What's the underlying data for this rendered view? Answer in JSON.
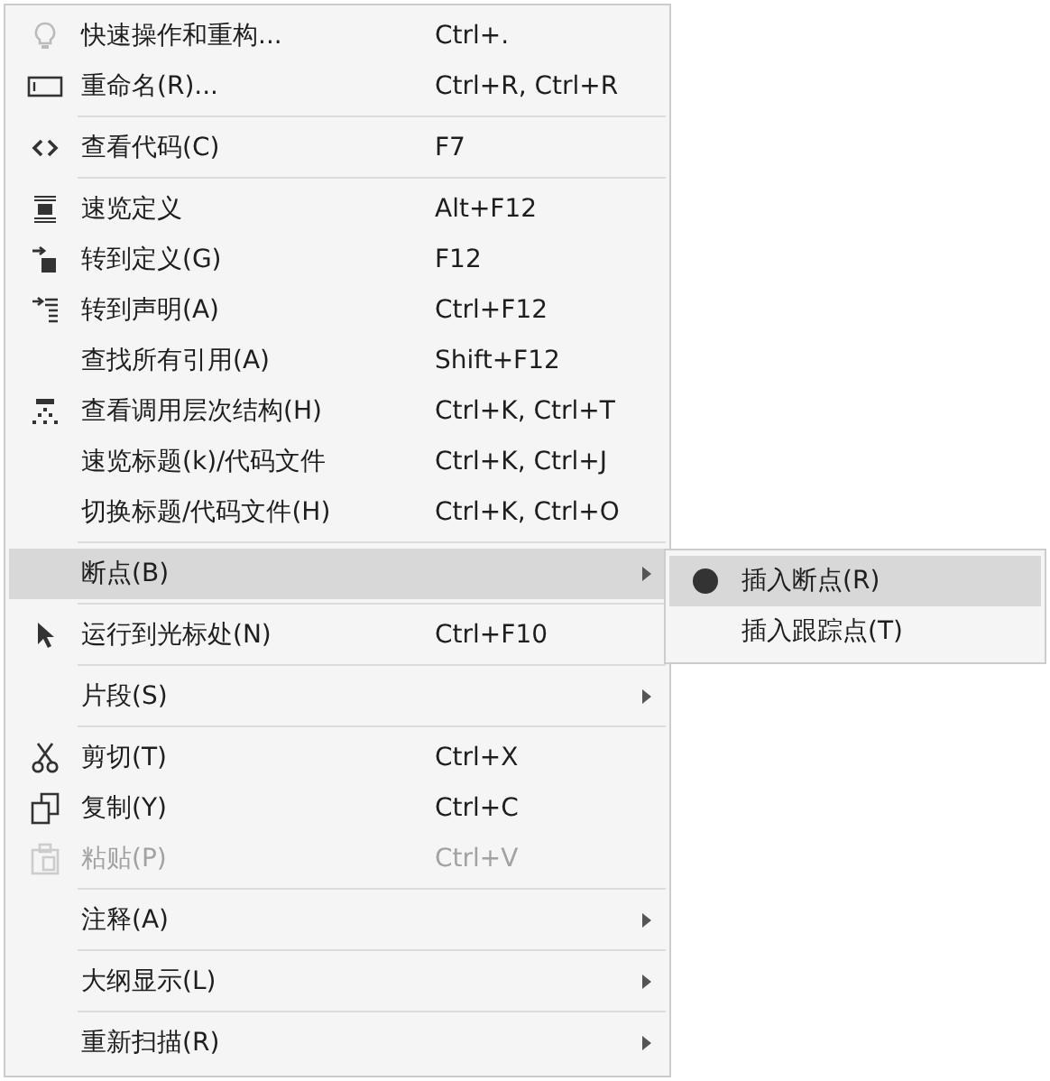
{
  "menu": {
    "items": [
      {
        "kind": "item",
        "label": "快速操作和重构...",
        "shortcut": "Ctrl+.",
        "has_submenu": false,
        "highlighted": false,
        "disabled": false
      },
      {
        "kind": "item",
        "label": "重命名(R)...",
        "shortcut": "Ctrl+R, Ctrl+R",
        "has_submenu": false,
        "highlighted": false,
        "disabled": false
      },
      {
        "kind": "separator"
      },
      {
        "kind": "item",
        "label": "查看代码(C)",
        "shortcut": "F7",
        "has_submenu": false,
        "highlighted": false,
        "disabled": false
      },
      {
        "kind": "separator"
      },
      {
        "kind": "item",
        "label": "速览定义",
        "shortcut": "Alt+F12",
        "has_submenu": false,
        "highlighted": false,
        "disabled": false
      },
      {
        "kind": "item",
        "label": "转到定义(G)",
        "shortcut": "F12",
        "has_submenu": false,
        "highlighted": false,
        "disabled": false
      },
      {
        "kind": "item",
        "label": "转到声明(A)",
        "shortcut": "Ctrl+F12",
        "has_submenu": false,
        "highlighted": false,
        "disabled": false
      },
      {
        "kind": "item",
        "label": "查找所有引用(A)",
        "shortcut": "Shift+F12",
        "has_submenu": false,
        "highlighted": false,
        "disabled": false
      },
      {
        "kind": "item",
        "label": "查看调用层次结构(H)",
        "shortcut": "Ctrl+K, Ctrl+T",
        "has_submenu": false,
        "highlighted": false,
        "disabled": false
      },
      {
        "kind": "item",
        "label": "速览标题(k)/代码文件",
        "shortcut": "Ctrl+K, Ctrl+J",
        "has_submenu": false,
        "highlighted": false,
        "disabled": false
      },
      {
        "kind": "item",
        "label": "切换标题/代码文件(H)",
        "shortcut": "Ctrl+K, Ctrl+O",
        "has_submenu": false,
        "highlighted": false,
        "disabled": false
      },
      {
        "kind": "separator"
      },
      {
        "kind": "item",
        "label": "断点(B)",
        "has_submenu": true,
        "highlighted": true,
        "disabled": false
      },
      {
        "kind": "separator"
      },
      {
        "kind": "item",
        "label": "运行到光标处(N)",
        "shortcut": "Ctrl+F10",
        "has_submenu": false,
        "highlighted": false,
        "disabled": false
      },
      {
        "kind": "separator"
      },
      {
        "kind": "item",
        "label": "片段(S)",
        "has_submenu": true,
        "highlighted": false,
        "disabled": false
      },
      {
        "kind": "separator"
      },
      {
        "kind": "item",
        "label": "剪切(T)",
        "shortcut": "Ctrl+X",
        "has_submenu": false,
        "highlighted": false,
        "disabled": false
      },
      {
        "kind": "item",
        "label": "复制(Y)",
        "shortcut": "Ctrl+C",
        "has_submenu": false,
        "highlighted": false,
        "disabled": false
      },
      {
        "kind": "item",
        "label": "粘贴(P)",
        "shortcut": "Ctrl+V",
        "has_submenu": false,
        "highlighted": false,
        "disabled": true
      },
      {
        "kind": "separator"
      },
      {
        "kind": "item",
        "label": "注释(A)",
        "has_submenu": true,
        "highlighted": false,
        "disabled": false
      },
      {
        "kind": "separator"
      },
      {
        "kind": "item",
        "label": "大纲显示(L)",
        "has_submenu": true,
        "highlighted": false,
        "disabled": false
      },
      {
        "kind": "separator"
      },
      {
        "kind": "item",
        "label": "重新扫描(R)",
        "has_submenu": true,
        "highlighted": false,
        "disabled": false
      }
    ]
  },
  "submenu": {
    "items": [
      {
        "label": "插入断点(R)",
        "highlighted": true
      },
      {
        "label": "插入跟踪点(T)",
        "highlighted": false
      }
    ]
  }
}
